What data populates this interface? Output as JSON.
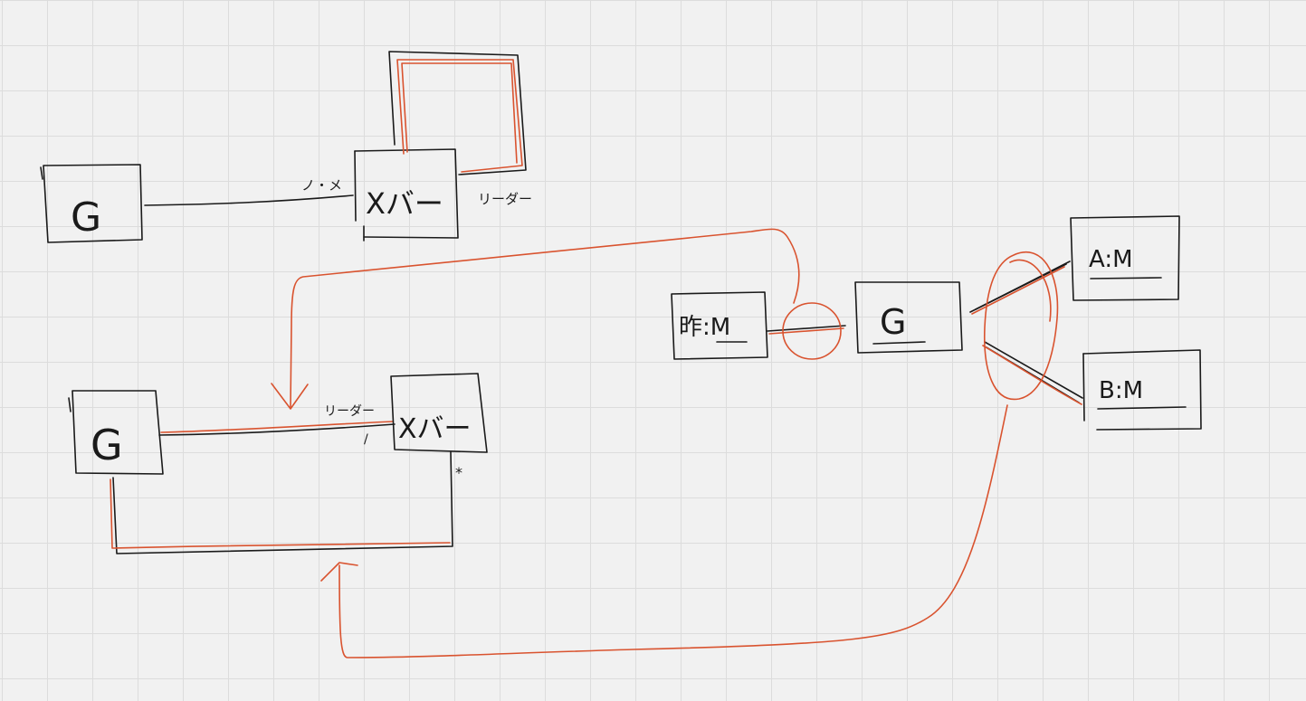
{
  "diagram": {
    "left_top": {
      "g_box": "G",
      "xbar_box": "Xバー",
      "rel_label_left": "ノ・メ",
      "rel_label_right": "リーダー"
    },
    "left_bottom": {
      "g_box": "G",
      "xbar_box": "Xバー",
      "rel_label_top": "リーダー",
      "rel_label_one": "/",
      "rel_label_many": "*"
    },
    "right": {
      "left_box": "昨:M",
      "g_box": "G",
      "a_box": "A:M",
      "b_box": "B:M"
    }
  },
  "colors": {
    "background": "#f1f1f1",
    "grid": "#dcdcdc",
    "ink": "#1a1a1a",
    "red_ink": "#d9532f"
  }
}
